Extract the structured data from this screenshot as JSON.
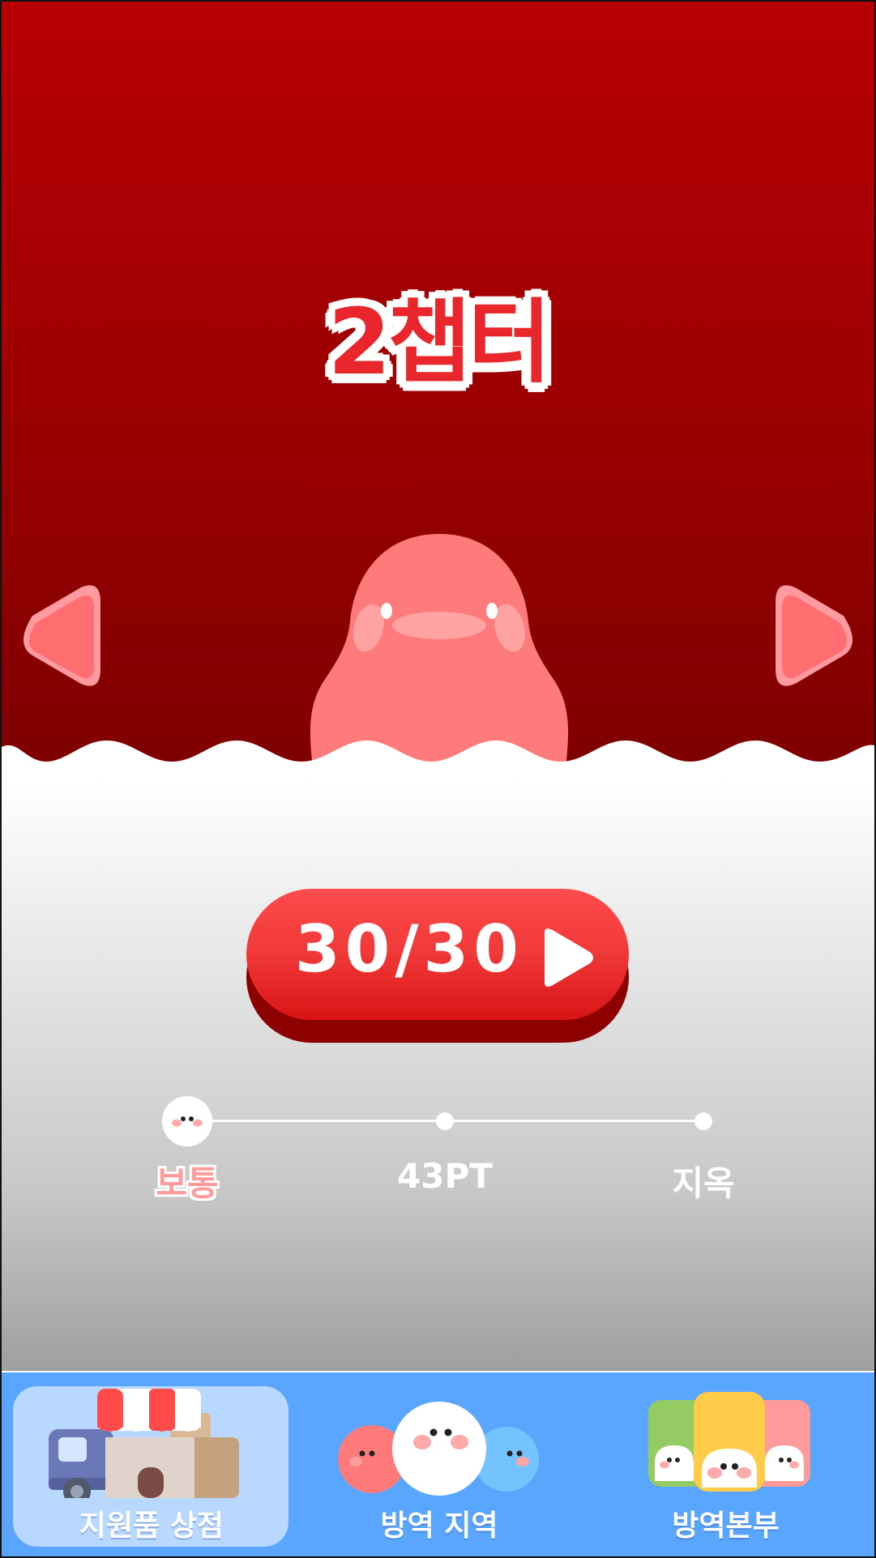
{
  "chapter": {
    "title": "2챕터"
  },
  "navigation": {
    "prev_icon": "left-triangle-arrow",
    "next_icon": "right-triangle-arrow"
  },
  "play": {
    "label": "30/30",
    "icon": "play-icon"
  },
  "difficulty": {
    "options": [
      "보통",
      "43PT",
      "지옥"
    ],
    "selected": "보통"
  },
  "bottom_nav": {
    "items": [
      {
        "label": "지원품 상점",
        "icon": "shop-truck-icon",
        "active": true
      },
      {
        "label": "방역 지역",
        "icon": "blob-creatures-icon",
        "active": false
      },
      {
        "label": "방역본부",
        "icon": "character-cards-icon",
        "active": false
      }
    ]
  },
  "colors": {
    "top_red": "#b80004",
    "button_red": "#f03838",
    "creature_pink": "#ff7b7b",
    "nav_blue": "#5aa6ff",
    "active_label_pink": "#ff9b9b"
  }
}
